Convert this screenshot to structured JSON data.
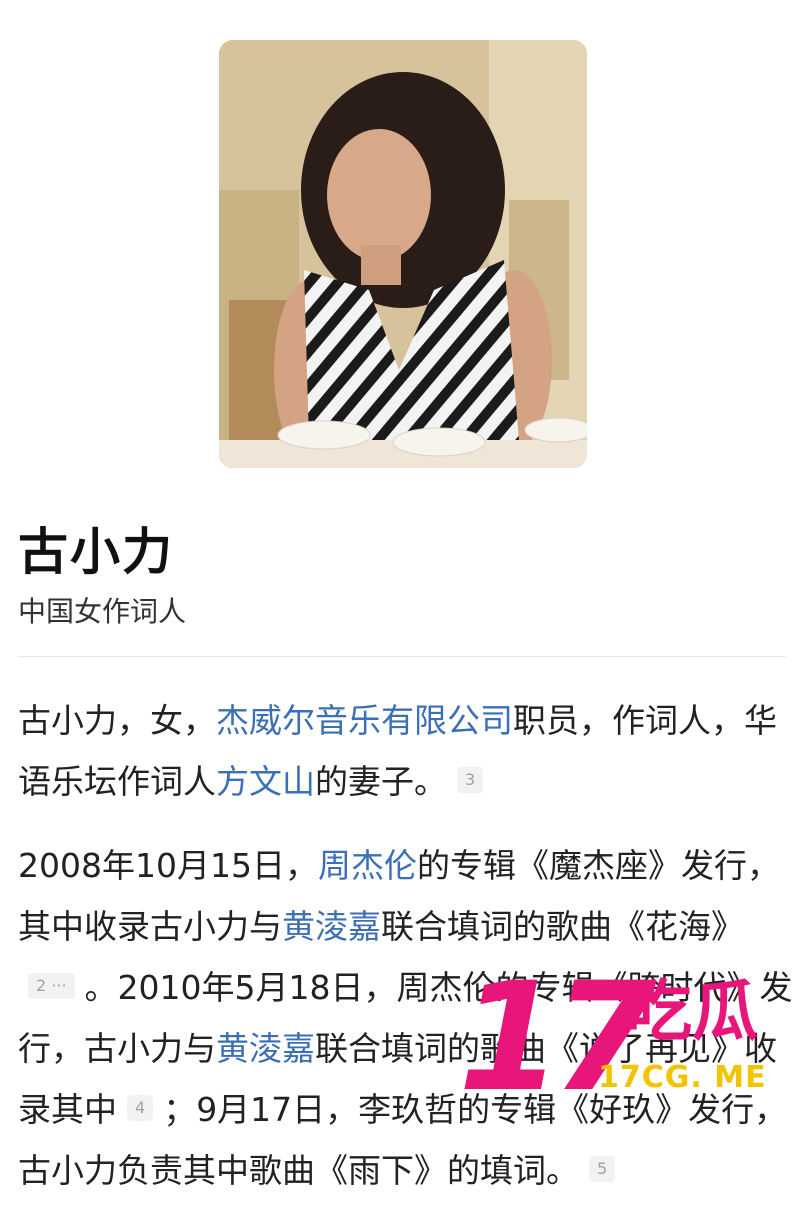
{
  "profile": {
    "name": "古小力",
    "description": "中国女作词人"
  },
  "paragraph1": {
    "t1": "古小力，女，",
    "link_company": "杰威尔音乐有限公司",
    "t2": "职员，作词人，华语乐坛作词人",
    "link_husband": "方文山",
    "t3": "的妻子。",
    "ref": "3"
  },
  "paragraph2": {
    "t1": "2008年10月15日，",
    "link_jay": "周杰伦",
    "t2": "的专辑《魔杰座》发行，其中收录古小力与",
    "link_huang": "黄淩嘉",
    "t3": "联合填词的歌曲《花海》",
    "ref1": "2 ···",
    "t4": "。2010年5月18日，周杰伦的专辑《跨时代》发行，古小力与",
    "link_huang2": "黄淩嘉",
    "t5": "联合填词的歌曲《说了再见》收录其中",
    "ref2": "4",
    "t6": "；9月17日，李玖哲的专辑《好玖》发行，古小力负责其中歌曲《雨下》的填词。",
    "ref3": "5"
  },
  "watermark": {
    "number": "17",
    "text": "吃瓜",
    "url": "17CG. ME"
  },
  "colors": {
    "link": "#3b6fb6",
    "watermark_pink": "#e8157a",
    "watermark_yellow": "#f2c400"
  }
}
